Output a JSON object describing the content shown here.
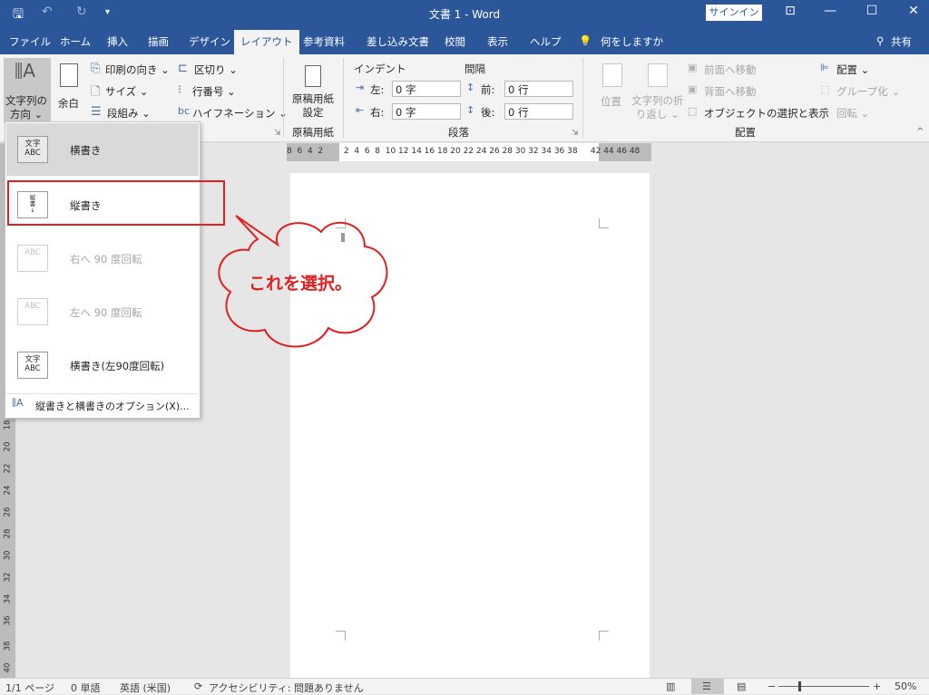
{
  "window": {
    "title": "文書 1  -  Word",
    "signin_label": "サインイン",
    "qat": {
      "save_icon": "floppy-icon",
      "undo_icon": "undo-icon",
      "redo_icon": "redo-icon",
      "customize_icon": "dropdown-icon"
    }
  },
  "tabs": [
    {
      "label": "ファイル"
    },
    {
      "label": "ホーム"
    },
    {
      "label": "挿入"
    },
    {
      "label": "描画"
    },
    {
      "label": "デザイン"
    },
    {
      "label": "レイアウト",
      "active": true
    },
    {
      "label": "参考資料"
    },
    {
      "label": "差し込み文書"
    },
    {
      "label": "校閲"
    },
    {
      "label": "表示"
    },
    {
      "label": "ヘルプ"
    },
    {
      "label": "何をしますか"
    }
  ],
  "share_label": "共有",
  "ribbon": {
    "page_setup": {
      "text_direction": "文字列の\n方向 ⌄",
      "margins": "余白",
      "orientation": "印刷の向き ⌄",
      "size": "サイズ ⌄",
      "columns": "段組み ⌄",
      "breaks": "区切り ⌄",
      "line_numbers": "行番号 ⌄",
      "hyphenation": "ハイフネーション ⌄"
    },
    "manuscript": {
      "button": "原稿用紙\n設定",
      "group": "原稿用紙"
    },
    "paragraph": {
      "indent_title": "インデント",
      "spacing_title": "間隔",
      "left_label": "左:",
      "left_value": "0 字",
      "right_label": "右:",
      "right_value": "0 字",
      "before_label": "前:",
      "before_value": "0 行",
      "after_label": "後:",
      "after_value": "0 行",
      "group": "段落"
    },
    "arrange": {
      "position": "位置",
      "wrap_text": "文字列の折\nり返し ⌄",
      "bring_forward": "前面へ移動",
      "send_backward": "背面へ移動",
      "selection_pane": "オブジェクトの選択と表示",
      "align": "配置 ⌄",
      "group_btn": "グループ化 ⌄",
      "rotate": "回転 ⌄",
      "group": "配置"
    }
  },
  "ruler": {
    "h_labels": "8  6  4  2        2  4  6  8  10 12 14 16 18 20 22 24 26 28 30 32 34 36 38     42 44 46 48",
    "v_labels": [
      "18",
      "20",
      "22",
      "24",
      "26",
      "28",
      "30",
      "32",
      "34",
      "36",
      "38",
      "40"
    ]
  },
  "dropdown": {
    "items": [
      {
        "label": "横書き",
        "icon_text": "文字\nABC",
        "state": "selected"
      },
      {
        "label": "縦書き",
        "icon_text": "縦\n書\n↓",
        "state": "normal"
      },
      {
        "label": "右へ 90 度回転",
        "icon_text": "ABC",
        "state": "disabled"
      },
      {
        "label": "左へ 90 度回転",
        "icon_text": "ABC",
        "state": "disabled"
      },
      {
        "label": "横書き(左90度回転)",
        "icon_text": "文字\nABC",
        "state": "normal"
      }
    ],
    "options_label": "縦書きと横書きのオプション(X)..."
  },
  "callout": {
    "text": "これを選択。",
    "color": "#e02020"
  },
  "statusbar": {
    "page": "1/1 ページ",
    "words": "0 単語",
    "language": "英語 (米国)",
    "accessibility": "アクセシビリティ: 問題ありません",
    "zoom": "50%"
  },
  "colors": {
    "accent": "#2b579a",
    "callout": "#e02020"
  }
}
